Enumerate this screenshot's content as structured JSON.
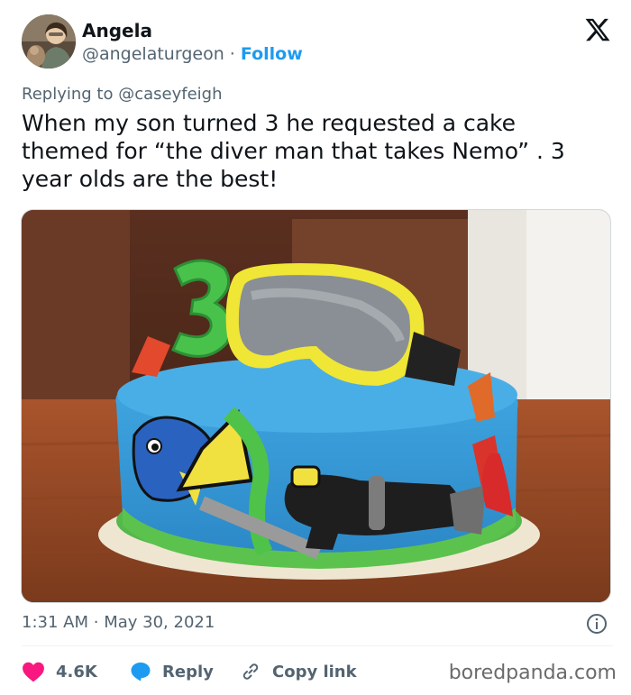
{
  "author": {
    "name": "Angela",
    "handle": "@angelaturgeon",
    "separator": "·",
    "follow_label": "Follow"
  },
  "replying": {
    "prefix": "Replying to",
    "mention": "@caseyfeigh"
  },
  "tweet": {
    "text": "When my son turned 3 he requested a cake themed for “the diver man that takes Nemo” . 3 year olds are the best!"
  },
  "media": {
    "cake_number": "3"
  },
  "meta": {
    "time": "1:31 AM",
    "separator": "·",
    "date": "May 30, 2021"
  },
  "actions": {
    "likes": "4.6K",
    "reply_label": "Reply",
    "copy_label": "Copy link"
  },
  "watermark": "boredpanda.com",
  "colors": {
    "like": "#f91880",
    "reply": "#1d9bf0",
    "link": "#1d9bf0",
    "muted": "#536471"
  },
  "icons": [
    "x-logo-icon",
    "heart-icon",
    "reply-bubble-icon",
    "link-icon",
    "info-icon"
  ]
}
